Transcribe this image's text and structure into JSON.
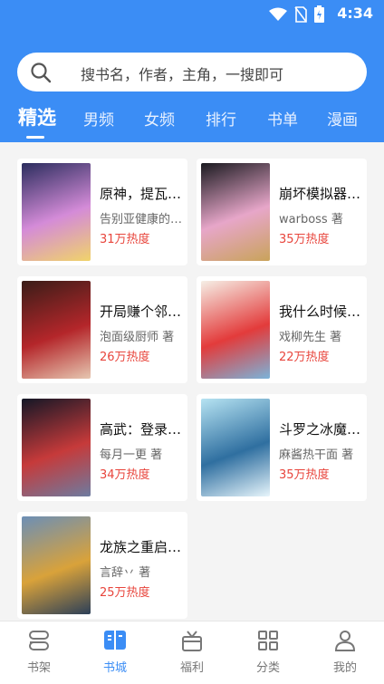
{
  "status_bar": {
    "time": "4:34"
  },
  "search": {
    "placeholder": "搜书名，作者，主角，一搜即可"
  },
  "tabs": [
    {
      "label": "精选",
      "active": true
    },
    {
      "label": "男频",
      "active": false
    },
    {
      "label": "女频",
      "active": false
    },
    {
      "label": "排行",
      "active": false
    },
    {
      "label": "书单",
      "active": false
    },
    {
      "label": "漫画",
      "active": false
    }
  ],
  "books": [
    {
      "title": "原神，提瓦…",
      "author": "告别亚健康的…",
      "heat": "31万热度",
      "cover_colors": [
        "#2b2d5e",
        "#d48bd8",
        "#f0d36a"
      ]
    },
    {
      "title": "崩坏模拟器…",
      "author": "warboss 著",
      "heat": "35万热度",
      "cover_colors": [
        "#1a1a20",
        "#e7a6c9",
        "#c9a35a"
      ]
    },
    {
      "title": "开局赚个邻…",
      "author": "泡面级厨师 著",
      "heat": "26万热度",
      "cover_colors": [
        "#3a1d18",
        "#b4262a",
        "#e6c7b1"
      ]
    },
    {
      "title": "我什么时候…",
      "author": "戏柳先生 著",
      "heat": "22万热度",
      "cover_colors": [
        "#f6efe6",
        "#e33b3b",
        "#7bb3d9"
      ]
    },
    {
      "title": "高武：登录…",
      "author": "每月一更 著",
      "heat": "34万热度",
      "cover_colors": [
        "#141726",
        "#c63a3a",
        "#6d7ba0"
      ]
    },
    {
      "title": "斗罗之冰魔…",
      "author": "麻酱热干面 著",
      "heat": "35万热度",
      "cover_colors": [
        "#b6e3f2",
        "#2f6fa0",
        "#e7f5fb"
      ]
    },
    {
      "title": "龙族之重启…",
      "author": "言辞丷 著",
      "heat": "25万热度",
      "cover_colors": [
        "#6c8fb6",
        "#d9a23a",
        "#2c3f58"
      ]
    }
  ],
  "bottom_nav": [
    {
      "label": "书架",
      "icon": "bookshelf-icon",
      "active": false
    },
    {
      "label": "书城",
      "icon": "book-open-icon",
      "active": true
    },
    {
      "label": "福利",
      "icon": "gift-icon",
      "active": false
    },
    {
      "label": "分类",
      "icon": "grid-icon",
      "active": false
    },
    {
      "label": "我的",
      "icon": "profile-icon",
      "active": false
    }
  ],
  "colors": {
    "primary": "#3b8df5",
    "heat": "#e8453c"
  }
}
